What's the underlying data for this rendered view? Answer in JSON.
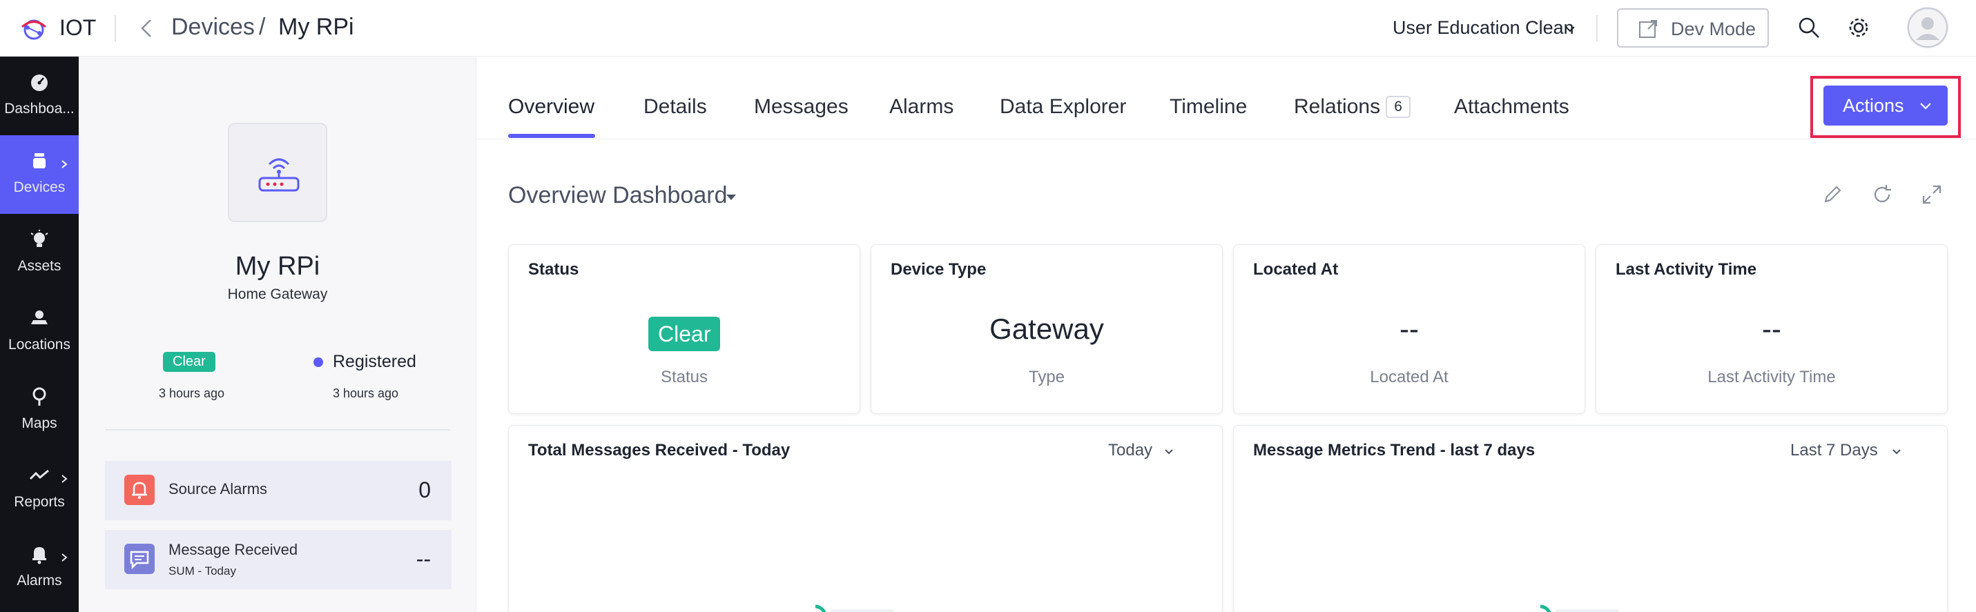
{
  "header": {
    "app_name": "IOT",
    "breadcrumb": [
      "Devices",
      "/",
      "My RPi"
    ],
    "org_name": "User Education Clean",
    "dev_mode_label": "Dev Mode"
  },
  "sidebar": {
    "items": [
      {
        "label": "Dashboa...",
        "icon": "gauge-icon"
      },
      {
        "label": "Devices",
        "icon": "device-icon",
        "active": true
      },
      {
        "label": "Assets",
        "icon": "bulb-icon"
      },
      {
        "label": "Locations",
        "icon": "location-icon"
      },
      {
        "label": "Maps",
        "icon": "map-pin-icon"
      },
      {
        "label": "Reports",
        "icon": "trend-icon"
      },
      {
        "label": "Alarms",
        "icon": "bell-icon"
      }
    ]
  },
  "device": {
    "name": "My RPi",
    "type": "Home Gateway",
    "status_badge": "Clear",
    "status_time": "3 hours ago",
    "registration": "Registered",
    "registration_time": "3 hours ago",
    "stats": [
      {
        "title": "Source Alarms",
        "value": "0",
        "icon": "bell-icon"
      },
      {
        "title": "Message Received",
        "subtitle": "SUM - Today",
        "value": "--",
        "icon": "message-icon"
      }
    ]
  },
  "tabs": [
    {
      "label": "Overview",
      "active": true
    },
    {
      "label": "Details"
    },
    {
      "label": "Messages"
    },
    {
      "label": "Alarms"
    },
    {
      "label": "Data Explorer"
    },
    {
      "label": "Timeline"
    },
    {
      "label": "Relations",
      "count": "6"
    },
    {
      "label": "Attachments"
    }
  ],
  "actions_label": "Actions",
  "dashboard": {
    "title": "Overview Dashboard",
    "cards": [
      {
        "title": "Status",
        "value": "Clear",
        "label": "Status"
      },
      {
        "title": "Device Type",
        "value": "Gateway",
        "label": "Type"
      },
      {
        "title": "Located At",
        "value": "--",
        "label": "Located At"
      },
      {
        "title": "Last Activity Time",
        "value": "--",
        "label": "Last Activity Time"
      }
    ],
    "widgets": [
      {
        "title": "Total Messages Received - Today",
        "range": "Today"
      },
      {
        "title": "Message Metrics Trend - last 7 days",
        "range": "Last 7 Days"
      }
    ]
  },
  "colors": {
    "accent": "#5b5cf6",
    "clear_green": "#21b895",
    "highlight_red": "#e3264d",
    "sidebar_bg": "#111318"
  }
}
